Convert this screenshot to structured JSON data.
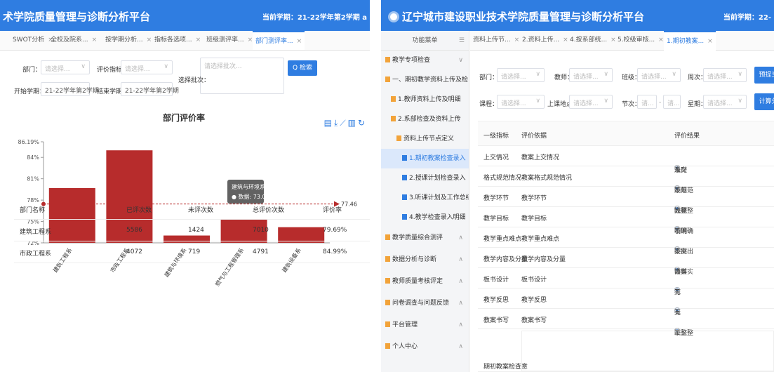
{
  "left": {
    "header": {
      "title": "术学院质量管理与诊断分析平台",
      "semester": "当前学期：21-22学年第2学期  a"
    },
    "tabs": [
      {
        "label": "SWOT分析",
        "active": false
      },
      {
        "label": "全校及院系...",
        "active": false
      },
      {
        "label": "按学期分析...",
        "active": false
      },
      {
        "label": "指标各选项...",
        "active": false
      },
      {
        "label": "班级测评率...",
        "active": false
      },
      {
        "label": "部门测评率...",
        "active": true
      }
    ],
    "filters": {
      "dept_label": "部门：",
      "dept_placeholder": "请选择...",
      "indicator_label": "评价指标：",
      "indicator_placeholder": "请选择...",
      "batch_label": "选择批次：",
      "batch_placeholder": "请选择批次...",
      "search_button": "Q 检索",
      "start_label": "开始学期：",
      "start_value": "21-22学年第2学期",
      "end_label": "结束学期：",
      "end_value": "21-22学年第2学期"
    },
    "chart_title": "部门评价率",
    "chart_data": {
      "type": "bar",
      "title": "部门评价率",
      "categories": [
        "建筑工程系",
        "市政工程系",
        "建筑与环境系",
        "燃气与工程管理系",
        "建筑设备系"
      ],
      "values": [
        79.69,
        84.99,
        73.03,
        75.3,
        74.2
      ],
      "ylim": [
        72,
        86.19
      ],
      "yticks": [
        "86.19%",
        "84%",
        "81%",
        "78%",
        "75%",
        "72%"
      ],
      "mark_line": {
        "value": 77.46,
        "label": "77.46"
      },
      "bar_color": "#b72c2c",
      "tooltip": {
        "category": "建筑与环境系",
        "text": "● 数据: 73.03"
      }
    },
    "table": {
      "headers": [
        "部门名称",
        "已评次数",
        "未评次数",
        "总评价次数",
        "评价率"
      ],
      "rows": [
        [
          "建筑工程系",
          "5586",
          "1424",
          "7010",
          "79.69%"
        ],
        [
          "市政工程系",
          "4072",
          "719",
          "4791",
          "84.99%"
        ]
      ]
    }
  },
  "right": {
    "header": {
      "title": "辽宁城市建设职业技术学院质量管理与诊断分析平台",
      "semester": "当前学期：22-"
    },
    "sidebar": {
      "title": "功能菜单",
      "items": [
        {
          "label": "教学专项检查",
          "color": "#f2a33a"
        },
        {
          "label": "一、期初教学资料上传及检",
          "color": "#f2a33a"
        },
        {
          "label": "1.教师资料上传及明细",
          "color": "#f2a33a"
        },
        {
          "label": "2.系部检查及资料上传",
          "color": "#f2a33a"
        },
        {
          "label": "资料上传节点定义",
          "color": "#f2a33a"
        },
        {
          "label": "1.期初教案检查录入",
          "color": "#2f7de1"
        },
        {
          "label": "2.授课计划检查录入",
          "color": "#2f7de1"
        },
        {
          "label": "3.听课计划及工作总结",
          "color": "#2f7de1"
        },
        {
          "label": "4.教学检查录入明细",
          "color": "#2f7de1"
        },
        {
          "label": "教学质量综合测评",
          "color": "#f2a33a"
        },
        {
          "label": "数据分析与诊断",
          "color": "#f2a33a"
        },
        {
          "label": "教师质量考核评定",
          "color": "#f2a33a"
        },
        {
          "label": "问卷调查与问题反馈",
          "color": "#f2a33a"
        },
        {
          "label": "平台管理",
          "color": "#f2a33a"
        },
        {
          "label": "个人中心",
          "color": "#f2a33a"
        }
      ]
    },
    "tabs": [
      {
        "label": "资料上传节...",
        "active": false
      },
      {
        "label": "2.资料上传...",
        "active": false
      },
      {
        "label": "4.按系部统...",
        "active": false
      },
      {
        "label": "5.校级审核...",
        "active": false
      },
      {
        "label": "1.期初教案...",
        "active": true
      }
    ],
    "filters": {
      "dept": "部门：",
      "teacher": "教师：",
      "class": "班级：",
      "week": "周次：",
      "course": "课程：",
      "place": "上课地点：",
      "section": "节次：",
      "weekday": "星期：",
      "placeholder": "请选择...",
      "placeholder_short": "请...",
      "btn1": "预提交",
      "btn2": "计算分"
    },
    "grid": {
      "headers": [
        "一级指标",
        "评价依据",
        "评价结果"
      ],
      "rows": [
        {
          "a": "上交情况",
          "b": "教案上交情况",
          "opts": [
            "及时",
            "迟交",
            "未交"
          ]
        },
        {
          "a": "格式规范情况",
          "b": "教案格式规范情况",
          "opts": [
            "规范",
            "较规范",
            "不规范"
          ]
        },
        {
          "a": "教学环节",
          "b": "教学环节",
          "opts": [
            "完整",
            "较完整",
            "缺项"
          ]
        },
        {
          "a": "教学目标",
          "b": "教学目标",
          "opts": [
            "明确",
            "较明确",
            "不明确"
          ]
        },
        {
          "a": "教学重点难点",
          "b": "教学重点难点",
          "opts": [
            "突出",
            "较突出",
            "不突出"
          ]
        },
        {
          "a": "教学内容及分量",
          "b": "教学内容及分量",
          "opts": [
            "详实",
            "较详实",
            "简单"
          ]
        },
        {
          "a": "板书设计",
          "b": "板书设计",
          "opts": [
            "有",
            "无"
          ]
        },
        {
          "a": "教学反思",
          "b": "教学反思",
          "opts": [
            "有",
            "无"
          ]
        },
        {
          "a": "教案书写",
          "b": "教案书写",
          "opts": [
            "工整",
            "较工整",
            "不工整"
          ]
        }
      ],
      "remark_label": "期初教案检查意"
    }
  }
}
